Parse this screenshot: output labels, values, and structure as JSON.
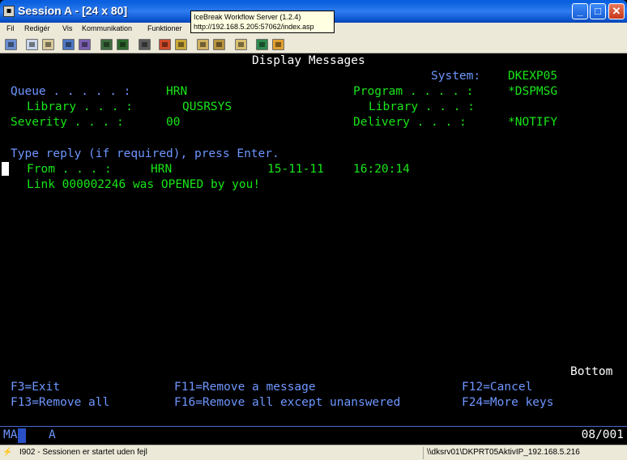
{
  "window": {
    "title": "Session A - [24 x 80]",
    "app_icon": "terminal-app-icon",
    "controls": {
      "minimize": "_",
      "maximize": "□",
      "close": "✕"
    }
  },
  "menu": [
    "Fil",
    "Redigér",
    "Vis",
    "Kommunikation",
    "Funktioner"
  ],
  "tooltip": {
    "line1": "IceBreak Workflow Server (1.2.4)",
    "line2": "http://192.168.5.205:57062/index.asp"
  },
  "toolbar_icons": [
    "print-screen-icon",
    "copy-icon",
    "paste-icon",
    "send-icon",
    "receive-icon",
    "display-icon",
    "color-icon",
    "record-macro-icon",
    "play-macro-icon",
    "stop-macro-icon",
    "clipboard-icon",
    "globe-icon",
    "edit-icon"
  ],
  "screen": {
    "title": "Display Messages",
    "system_label": "System:",
    "system_value": "DKEXP05",
    "queue_label": "Queue . . . . . :",
    "queue_value": "HRN",
    "program_label": "Program . . . . :",
    "program_value": "*DSPMSG",
    "library_label": "Library . . . :",
    "library_value": "QUSRSYS",
    "library2_label": "Library . . . :",
    "severity_label": "Severity . . . :",
    "severity_value": "00",
    "delivery_label": "Delivery . . . :",
    "delivery_value": "*NOTIFY",
    "instruction": "Type reply (if required), press Enter.",
    "from_label": "From . . . :",
    "from_user": "HRN",
    "from_date": "15-11-11",
    "from_time": "16:20:14",
    "message": "Link 000002246 was OPENED by you!",
    "bottom": "Bottom",
    "fkeys": {
      "f3": "F3=Exit",
      "f11": "F11=Remove a message",
      "f12": "F12=Cancel",
      "f13": "F13=Remove all",
      "f16": "F16=Remove all except unanswered",
      "f24": "F24=More keys"
    }
  },
  "oia": {
    "ma": "MA",
    "a": "A",
    "cursor_pos": "08/001"
  },
  "statusbar": {
    "message": "I902 - Sessionen er startet uden fejl",
    "right": "\\\\dksrv01\\DKPRT05AktivIP_192.168.5.216"
  },
  "colors": {
    "white": "#ffffff",
    "green": "#19e619",
    "blue": "#6e96ff",
    "background": "#000000"
  }
}
